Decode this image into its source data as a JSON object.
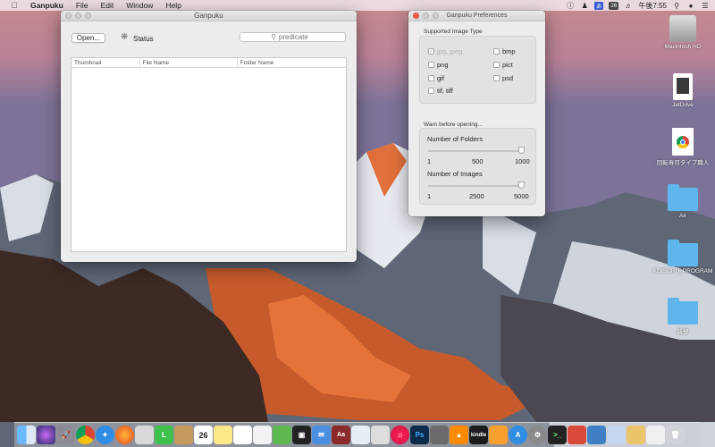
{
  "menubar": {
    "app_name": "Ganpuku",
    "items": [
      "File",
      "Edit",
      "Window",
      "Help"
    ],
    "date_badge": "26",
    "clock": "午後7:55"
  },
  "main_window": {
    "title": "Ganpuku",
    "open_button": "Open...",
    "status_label": "Status",
    "search_placeholder": "predicate",
    "columns": [
      "Thumbnail",
      "File Name",
      "Folder Name"
    ]
  },
  "prefs_window": {
    "title": "Ganpuku Preferences",
    "image_types_label": "Supported Image Type",
    "image_types": [
      {
        "label": "jpg, jpeg",
        "checked": true,
        "enabled": false
      },
      {
        "label": "bmp",
        "checked": false,
        "enabled": true
      },
      {
        "label": "png",
        "checked": false,
        "enabled": true
      },
      {
        "label": "pict",
        "checked": false,
        "enabled": true
      },
      {
        "label": "gif",
        "checked": false,
        "enabled": true
      },
      {
        "label": "psd",
        "checked": false,
        "enabled": true
      },
      {
        "label": "tif, tiff",
        "checked": false,
        "enabled": true
      }
    ],
    "warn_label": "Warn before opening...",
    "folders_slider": {
      "label": "Number of Folders",
      "ticks": [
        "1",
        "500",
        "1000"
      ],
      "value": 1000
    },
    "images_slider": {
      "label": "Number of Images",
      "ticks": [
        "1",
        "2500",
        "5000"
      ],
      "value": 5000
    }
  },
  "desktop": {
    "icons": [
      "Macintosh HD",
      "JetDrive",
      "回転寿司タイプ職人",
      "Air",
      "KOISURU_PROGRAM",
      "新規"
    ]
  },
  "dock": {
    "apps": [
      "finder-icon",
      "siri-icon",
      "launchpad-icon",
      "chrome-icon",
      "safari-icon",
      "firefox-icon",
      "photos-icon",
      "line-icon",
      "contacts-icon",
      "calendar-icon",
      "notes-icon",
      "reminders-icon",
      "textedit-icon",
      "evernote-icon",
      "qt-icon",
      "mail-icon",
      "dictionary-icon",
      "preview-icon",
      "itunes-icon",
      "photoshop-icon",
      "vlc-icon",
      "kindle-icon",
      "books-icon",
      "appstore-icon",
      "system-preferences-icon",
      "terminal-icon",
      "xcode-icon",
      "finder2-icon",
      "archive-icon",
      "downloads-icon",
      "trash-icon"
    ],
    "calendar_day": "26",
    "kindle_label": "kindle"
  },
  "colors": {
    "accent": "#5eb6ec",
    "close_red": "#fc5f57"
  }
}
